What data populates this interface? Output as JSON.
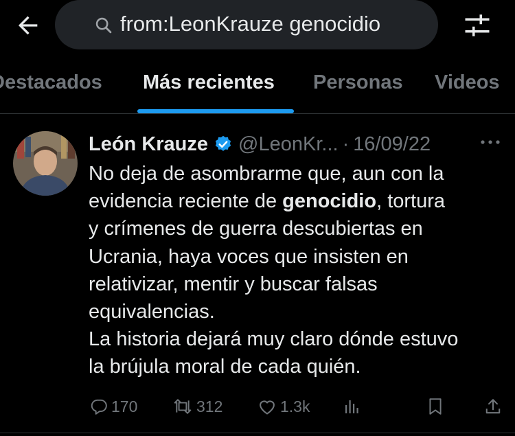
{
  "search": {
    "query": "from:LeonKrauze genocidio"
  },
  "tabs": [
    {
      "label": "Destacados"
    },
    {
      "label": "Más recientes"
    },
    {
      "label": "Personas"
    },
    {
      "label": "Videos"
    }
  ],
  "tweet": {
    "author_name": "León Krauze",
    "handle": "@LeonKr...",
    "separator": "·",
    "date": "16/09/22",
    "more": "···",
    "text_lines": [
      [
        "No deja de asombrarme que, aun con la"
      ],
      [
        "evidencia  reciente de ",
        "genocidio",
        ", tortura"
      ],
      [
        "y crímenes de guerra descubiertas en"
      ],
      [
        "Ucrania, haya voces que insisten en"
      ],
      [
        "relativizar, mentir y buscar falsas"
      ],
      [
        "equivalencias."
      ],
      [
        "La historia dejará muy claro dónde estuvo"
      ],
      [
        "la brújula moral de cada quién."
      ]
    ],
    "replies": "170",
    "retweets": "312",
    "likes": "1.3k"
  },
  "icons": {
    "back": "arrow-left-icon",
    "search": "search-icon",
    "filter": "sliders-icon",
    "verified": "verified-badge-icon",
    "reply": "reply-icon",
    "retweet": "retweet-icon",
    "like": "heart-icon",
    "views": "analytics-icon",
    "bookmark": "bookmark-icon",
    "share": "share-icon"
  },
  "colors": {
    "accent": "#1d9bf0",
    "background": "#000000",
    "muted": "#71767b",
    "text": "#e7e9ea"
  }
}
